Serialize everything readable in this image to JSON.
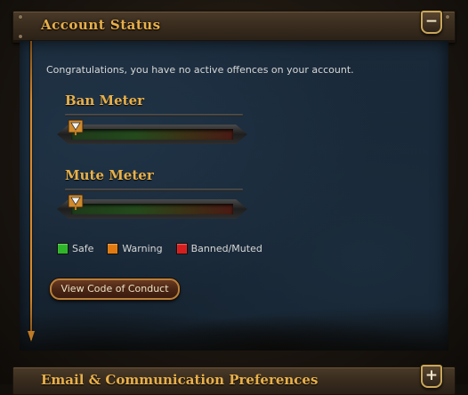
{
  "account_status": {
    "title": "Account Status",
    "collapse_label": "−",
    "message": "Congratulations, you have no active offences on your account.",
    "meters": [
      {
        "title": "Ban Meter",
        "level": 0
      },
      {
        "title": "Mute Meter",
        "level": 0
      }
    ],
    "legend": [
      {
        "label": "Safe",
        "color": "#2fb52a"
      },
      {
        "label": "Warning",
        "color": "#e07a10"
      },
      {
        "label": "Banned/Muted",
        "color": "#d61e1e"
      }
    ],
    "code_of_conduct_button": "View Code of Conduct"
  },
  "email_section": {
    "title": "Email & Communication Preferences",
    "expand_label": "+"
  },
  "colors": {
    "heading": "#e8b04a",
    "panel": "#1a2a3a",
    "accent_line": "#d9892a"
  }
}
